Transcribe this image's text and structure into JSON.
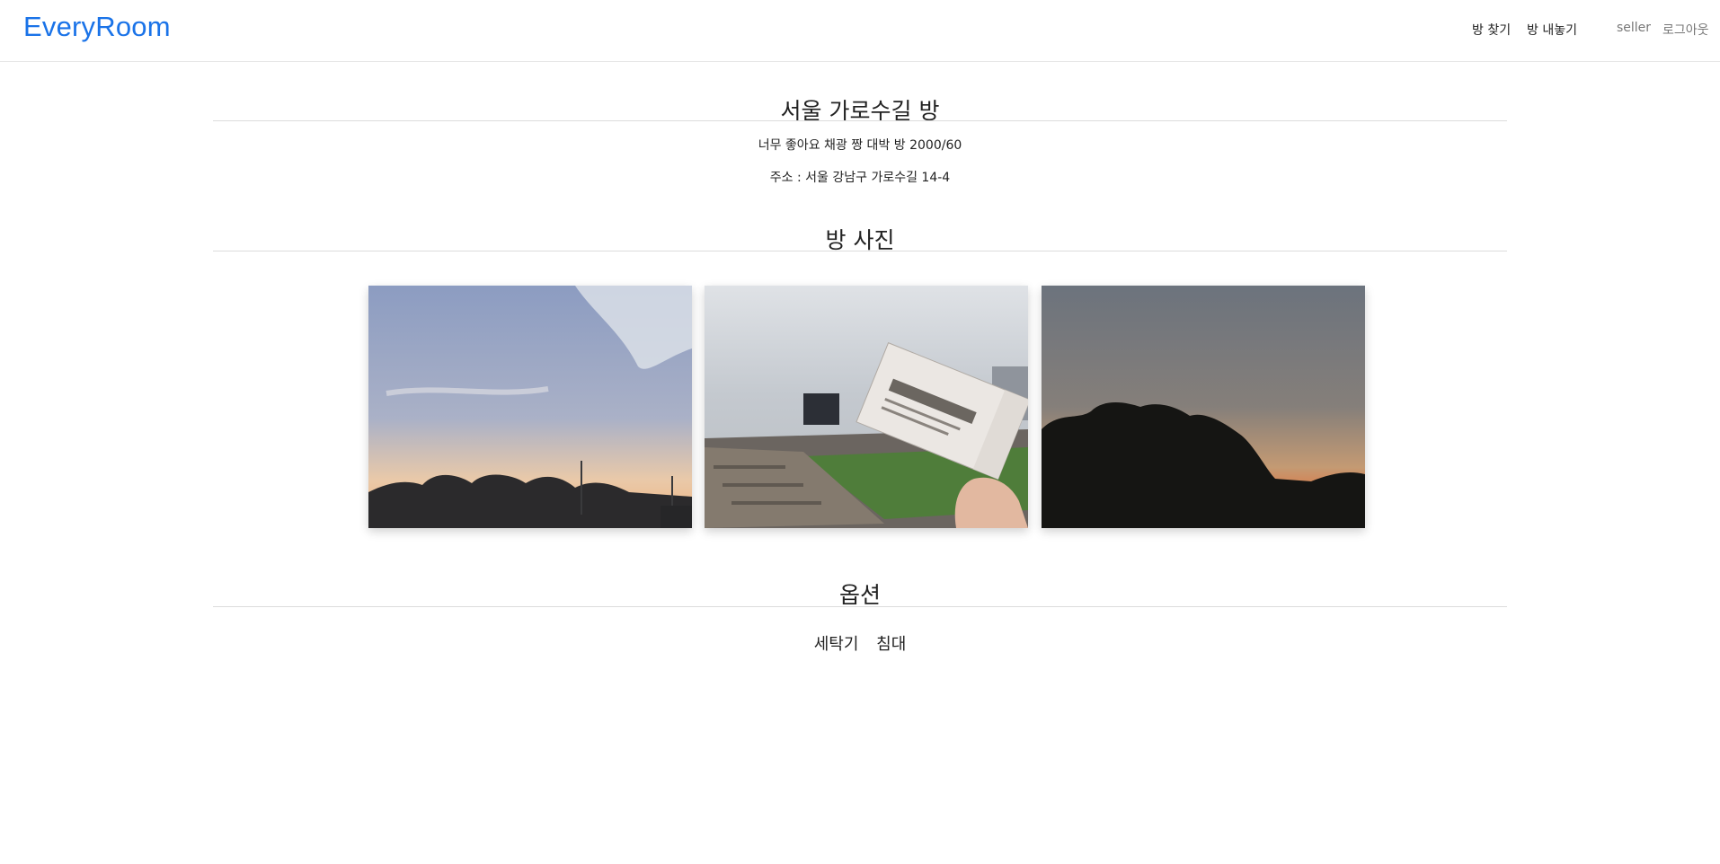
{
  "navbar": {
    "brand": "EveryRoom",
    "links": [
      "방 찾기",
      "방 내놓기"
    ],
    "user": "seller",
    "logout": "로그아웃"
  },
  "room": {
    "title": "서울 가로수길 방",
    "description": "너무 좋아요 채광 짱 대박 방 2000/60",
    "address": "주소 : 서울 강남구 가로수길 14-4"
  },
  "photos_section": {
    "title": "방 사진",
    "photos": [
      {
        "name": "sunset-sky-photo",
        "colors": {
          "top": "#8b9bc0",
          "bottom": "#f0b27a"
        }
      },
      {
        "name": "stadium-ticket-photo",
        "colors": {
          "top": "#d7dbe0",
          "bottom": "#4f7d3a"
        }
      },
      {
        "name": "dusk-trees-photo",
        "colors": {
          "top": "#6e7580",
          "bottom": "#d9784a"
        }
      }
    ]
  },
  "options_section": {
    "title": "옵션",
    "items": [
      "세탁기",
      "침대"
    ]
  },
  "colors": {
    "brand": "#1a73e8"
  }
}
